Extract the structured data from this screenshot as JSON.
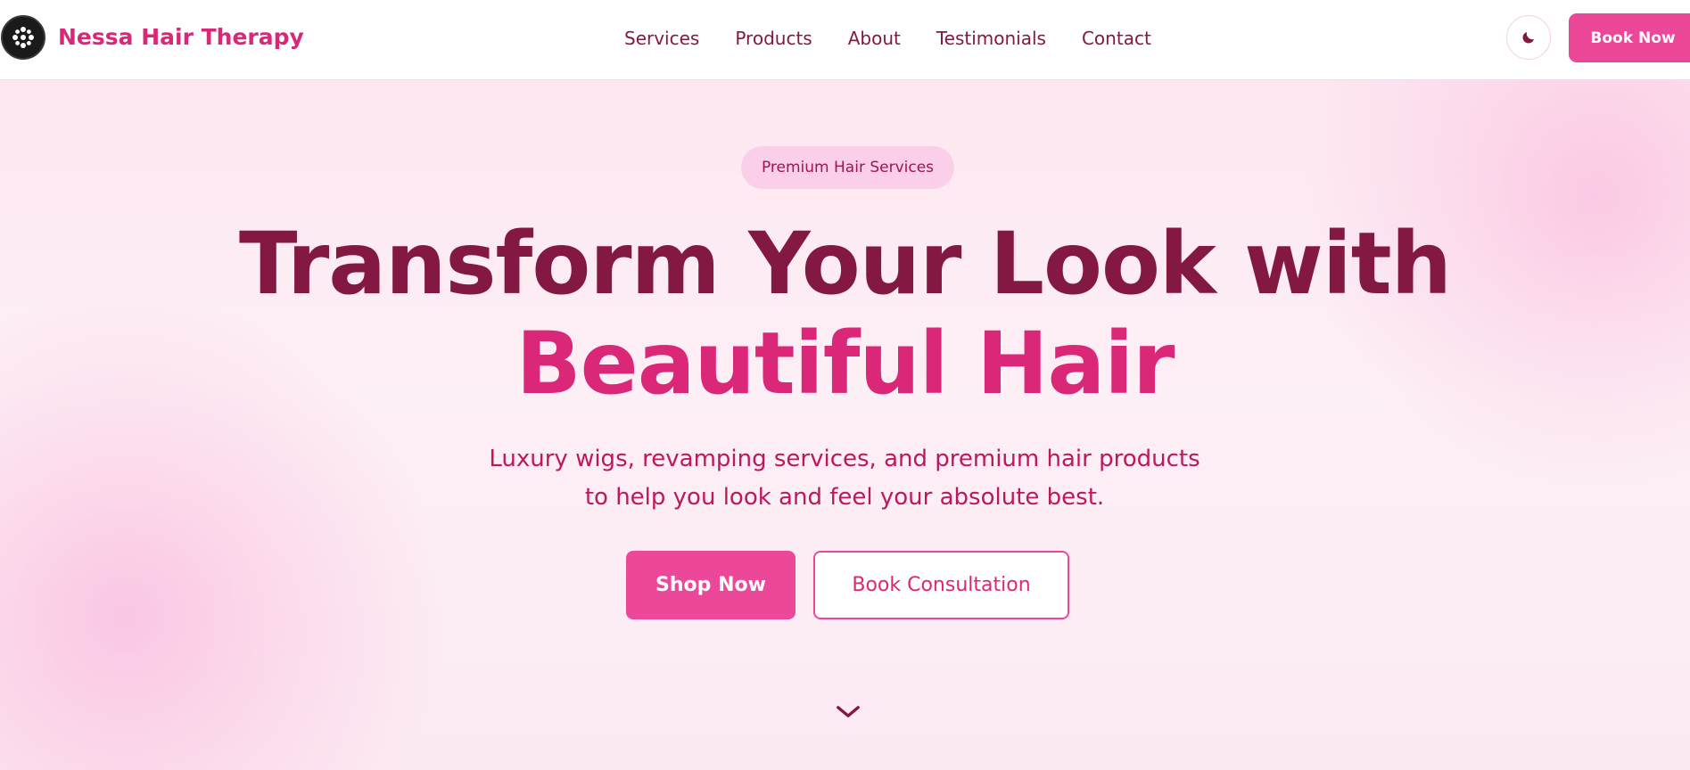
{
  "navbar": {
    "brand": "Nessa Hair Therapy",
    "links": [
      "Services",
      "Products",
      "About",
      "Testimonials",
      "Contact"
    ],
    "theme_toggle_icon": "moon-icon",
    "book_now_label": "Book Now"
  },
  "hero": {
    "badge": "Premium Hair Services",
    "headline_line1": "Transform Your Look with",
    "headline_line2": "Beautiful Hair",
    "subtitle_line1": "Luxury wigs, revamping services, and premium hair products",
    "subtitle_line2": "to help you look and feel your absolute best.",
    "primary_cta": "Shop Now",
    "secondary_cta": "Book Consultation",
    "scroll_icon": "chevron-down-icon"
  },
  "colors": {
    "primary": "#ec4899",
    "primary_dark": "#db2777",
    "heading": "#831843",
    "badge_bg": "#fbcfe8",
    "background": "#fdeff6"
  }
}
